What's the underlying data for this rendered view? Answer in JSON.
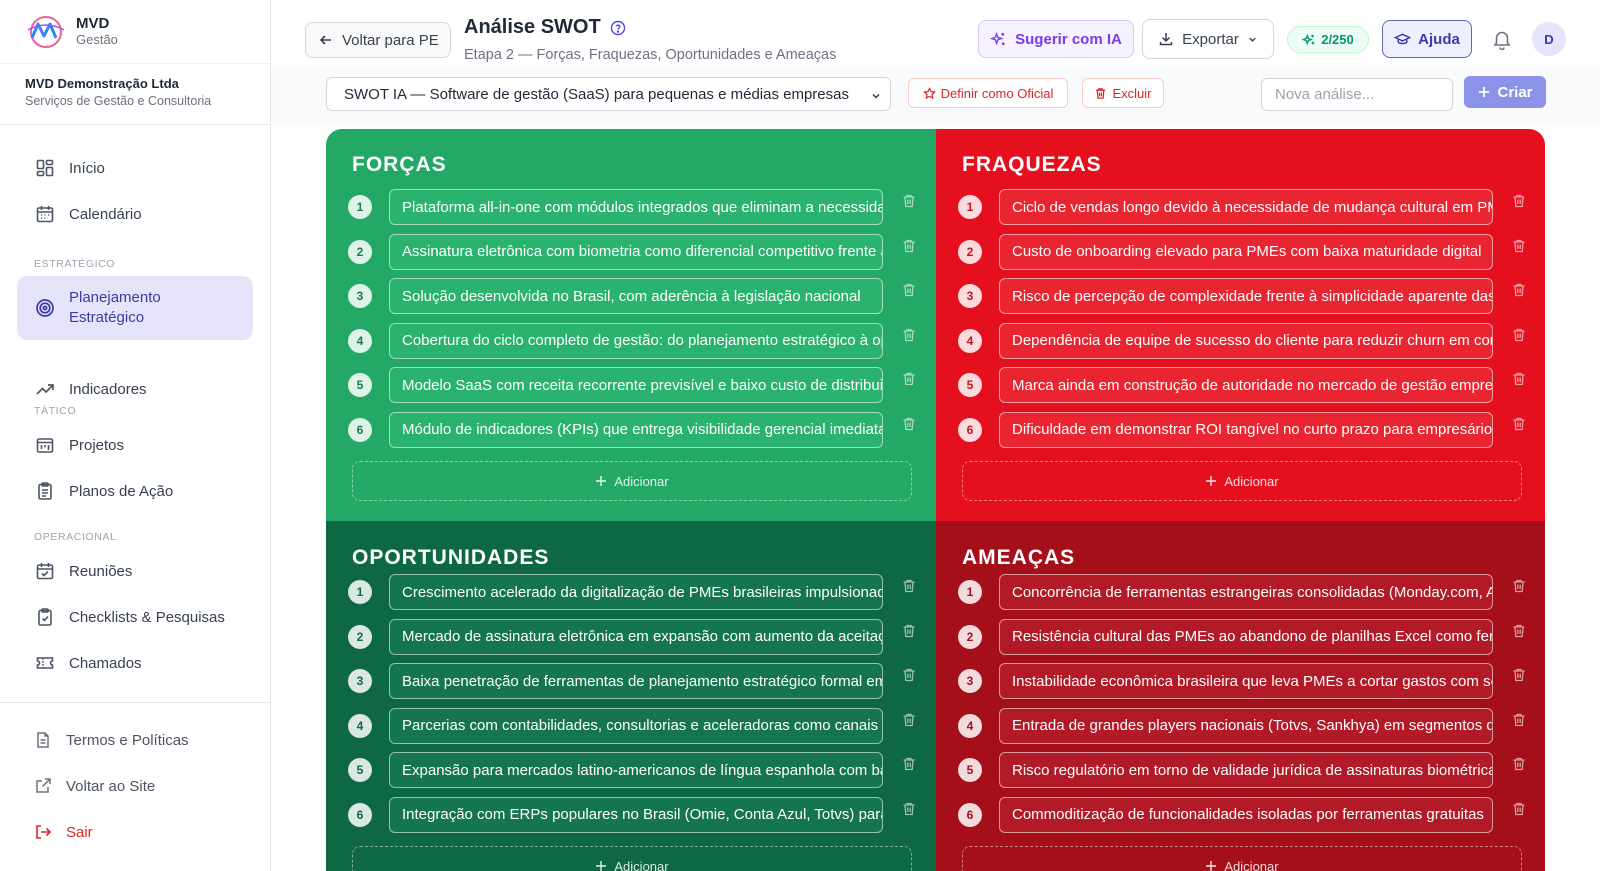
{
  "brand": {
    "name": "MVD",
    "sub": "Gestão"
  },
  "company": {
    "name": "MVD Demonstração Ltda",
    "desc": "Serviços de Gestão e Consultoria"
  },
  "nav": {
    "inicio": "Início",
    "calendario": "Calendário",
    "sec_estrategico": "ESTRATÉGICO",
    "planejamento": "Planejamento Estratégico",
    "indicadores": "Indicadores",
    "sec_tatico": "TÁTICO",
    "projetos": "Projetos",
    "planos": "Planos de Ação",
    "sec_operacional": "OPERACIONAL",
    "reunioes": "Reuniões",
    "checklists": "Checklists & Pesquisas",
    "chamados": "Chamados"
  },
  "bottom_nav": {
    "termos": "Termos e Políticas",
    "voltar_site": "Voltar ao Site",
    "sair": "Sair"
  },
  "header": {
    "back": "Voltar para PE",
    "title": "Análise SWOT",
    "subtitle": "Etapa 2 — Forças, Fraquezas, Oportunidades e Ameaças",
    "suggest": "Sugerir com IA",
    "export": "Exportar",
    "credits": "2/250",
    "help": "Ajuda",
    "avatar": "D"
  },
  "toolbar": {
    "selected": "SWOT IA — Software de gestão (SaaS) para pequenas e médias empresas",
    "set_official": "Definir como Oficial",
    "delete": "Excluir",
    "new_placeholder": "Nova análise...",
    "create": "Criar"
  },
  "colors": {
    "forcas": "#24a865",
    "fraquezas": "#e5101e",
    "oportunidades": "#0d6843",
    "ameacas": "#a50f1a",
    "accent": "#3b3ba8"
  },
  "add_label": "Adicionar",
  "quadrants": {
    "forcas": {
      "title": "FORÇAS",
      "items": [
        {
          "n": "1",
          "text": "Plataforma all-in-one com módulos integrados que eliminam a necessidade de múltiplas ferramentas"
        },
        {
          "n": "2",
          "text": "Assinatura eletrônica com biometria como diferencial competitivo frente aos concorrentes"
        },
        {
          "n": "3",
          "text": "Solução desenvolvida no Brasil, com aderência à legislação nacional"
        },
        {
          "n": "4",
          "text": "Cobertura do ciclo completo de gestão: do planejamento estratégico à operação"
        },
        {
          "n": "5",
          "text": "Modelo SaaS com receita recorrente previsível e baixo custo de distribuição"
        },
        {
          "n": "6",
          "text": "Módulo de indicadores (KPIs) que entrega visibilidade gerencial imediata"
        }
      ]
    },
    "fraquezas": {
      "title": "FRAQUEZAS",
      "items": [
        {
          "n": "1",
          "text": "Ciclo de vendas longo devido à necessidade de mudança cultural em PMEs"
        },
        {
          "n": "2",
          "text": "Custo de onboarding elevado para PMEs com baixa maturidade digital"
        },
        {
          "n": "3",
          "text": "Risco de percepção de complexidade frente à simplicidade aparente das planilhas"
        },
        {
          "n": "4",
          "text": "Dependência de equipe de sucesso do cliente para reduzir churn em contas pequenas"
        },
        {
          "n": "5",
          "text": "Marca ainda em construção de autoridade no mercado de gestão empresarial"
        },
        {
          "n": "6",
          "text": "Dificuldade em demonstrar ROI tangível no curto prazo para empresários"
        }
      ]
    },
    "oportunidades": {
      "title": "OPORTUNIDADES",
      "items": [
        {
          "n": "1",
          "text": "Crescimento acelerado da digitalização de PMEs brasileiras impulsionado pela pandemia"
        },
        {
          "n": "2",
          "text": "Mercado de assinatura eletrônica em expansão com aumento da aceitação jurídica"
        },
        {
          "n": "3",
          "text": "Baixa penetração de ferramentas de planejamento estratégico formal em PMEs"
        },
        {
          "n": "4",
          "text": "Parcerias com contabilidades, consultorias e aceleradoras como canais de venda"
        },
        {
          "n": "5",
          "text": "Expansão para mercados latino-americanos de língua espanhola com baixa concorrência"
        },
        {
          "n": "6",
          "text": "Integração com ERPs populares no Brasil (Omie, Conta Azul, Totvs) para ampliar valor"
        }
      ]
    },
    "ameacas": {
      "title": "AMEAÇAS",
      "items": [
        {
          "n": "1",
          "text": "Concorrência de ferramentas estrangeiras consolidadas (Monday.com, Asana, ClickUp)"
        },
        {
          "n": "2",
          "text": "Resistência cultural das PMEs ao abandono de planilhas Excel como ferramenta principal"
        },
        {
          "n": "3",
          "text": "Instabilidade econômica brasileira que leva PMEs a cortar gastos com software"
        },
        {
          "n": "4",
          "text": "Entrada de grandes players nacionais (Totvs, Sankhya) em segmentos de PMEs"
        },
        {
          "n": "5",
          "text": "Risco regulatório em torno de validade jurídica de assinaturas biométricas"
        },
        {
          "n": "6",
          "text": "Commoditização de funcionalidades isoladas por ferramentas gratuitas"
        }
      ]
    }
  }
}
